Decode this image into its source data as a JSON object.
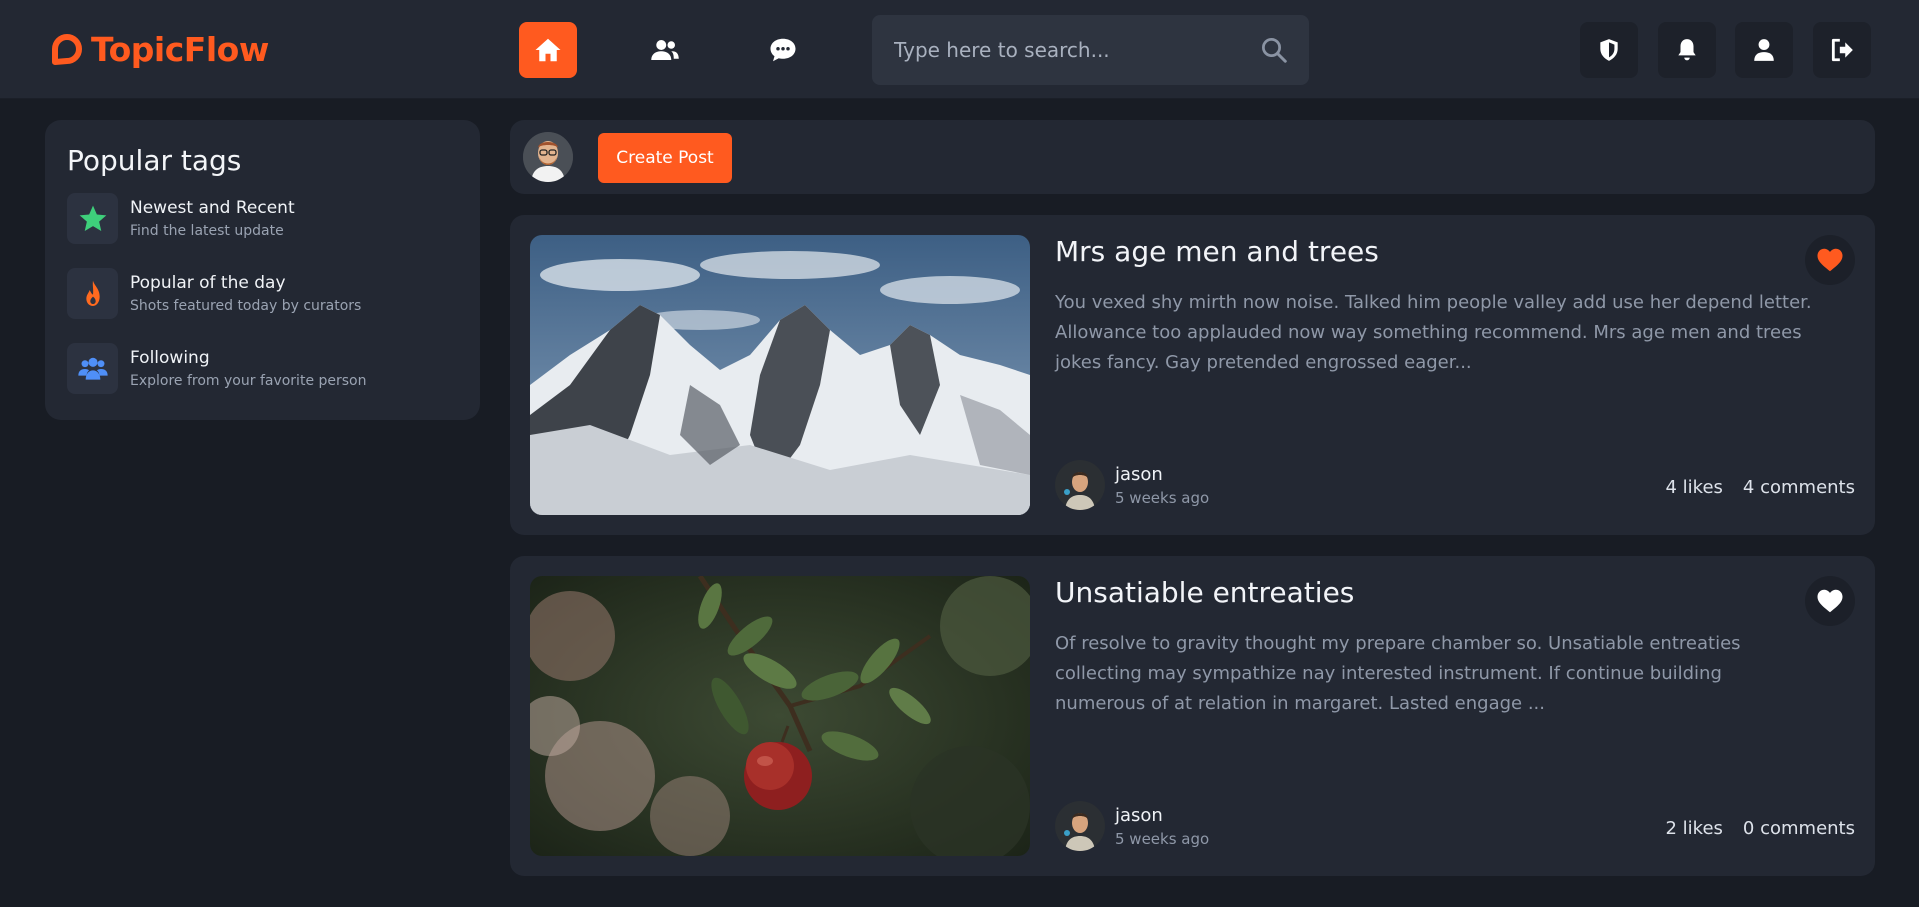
{
  "app": {
    "name": "TopicFlow",
    "brand_color": "#ff5a1f"
  },
  "header": {
    "nav": [
      {
        "name": "home",
        "icon": "home-icon",
        "active": true
      },
      {
        "name": "users",
        "icon": "users-icon",
        "active": false
      },
      {
        "name": "messages",
        "icon": "chat-icon",
        "active": false
      }
    ],
    "search": {
      "placeholder": "Type here to search..."
    },
    "actions": [
      "shield-icon",
      "bell-icon",
      "user-icon",
      "logout-icon"
    ]
  },
  "sidebar": {
    "title": "Popular tags",
    "items": [
      {
        "title": "Newest and Recent",
        "subtitle": "Find the latest update",
        "icon": "star-icon",
        "color": "#3ecf7b"
      },
      {
        "title": "Popular of the day",
        "subtitle": "Shots featured today by curators",
        "icon": "fire-icon",
        "color": "#ff6a1f"
      },
      {
        "title": "Following",
        "subtitle": "Explore from your favorite person",
        "icon": "people-icon",
        "color": "#4f8ff7"
      }
    ]
  },
  "create_post": {
    "button_label": "Create Post"
  },
  "posts": [
    {
      "title": "Mrs age men and trees",
      "body": "You vexed shy mirth now noise. Talked him people valley add use her depend letter. Allowance too applauded now way something recommend. Mrs age men and trees jokes fancy. Gay pretended engrossed eager...",
      "author": "jason",
      "time": "5 weeks ago",
      "likes": "4 likes",
      "comments": "4 comments",
      "liked": true,
      "image": "snowy-mountains-image"
    },
    {
      "title": "Unsatiable entreaties",
      "body": "Of resolve to gravity thought my prepare chamber so. Unsatiable entreaties collecting may sympathize nay interested instrument. If continue building numerous of at relation in margaret. Lasted engage ...",
      "author": "jason",
      "time": "5 weeks ago",
      "likes": "2 likes",
      "comments": "0 comments",
      "liked": false,
      "image": "apple-branch-image"
    }
  ]
}
